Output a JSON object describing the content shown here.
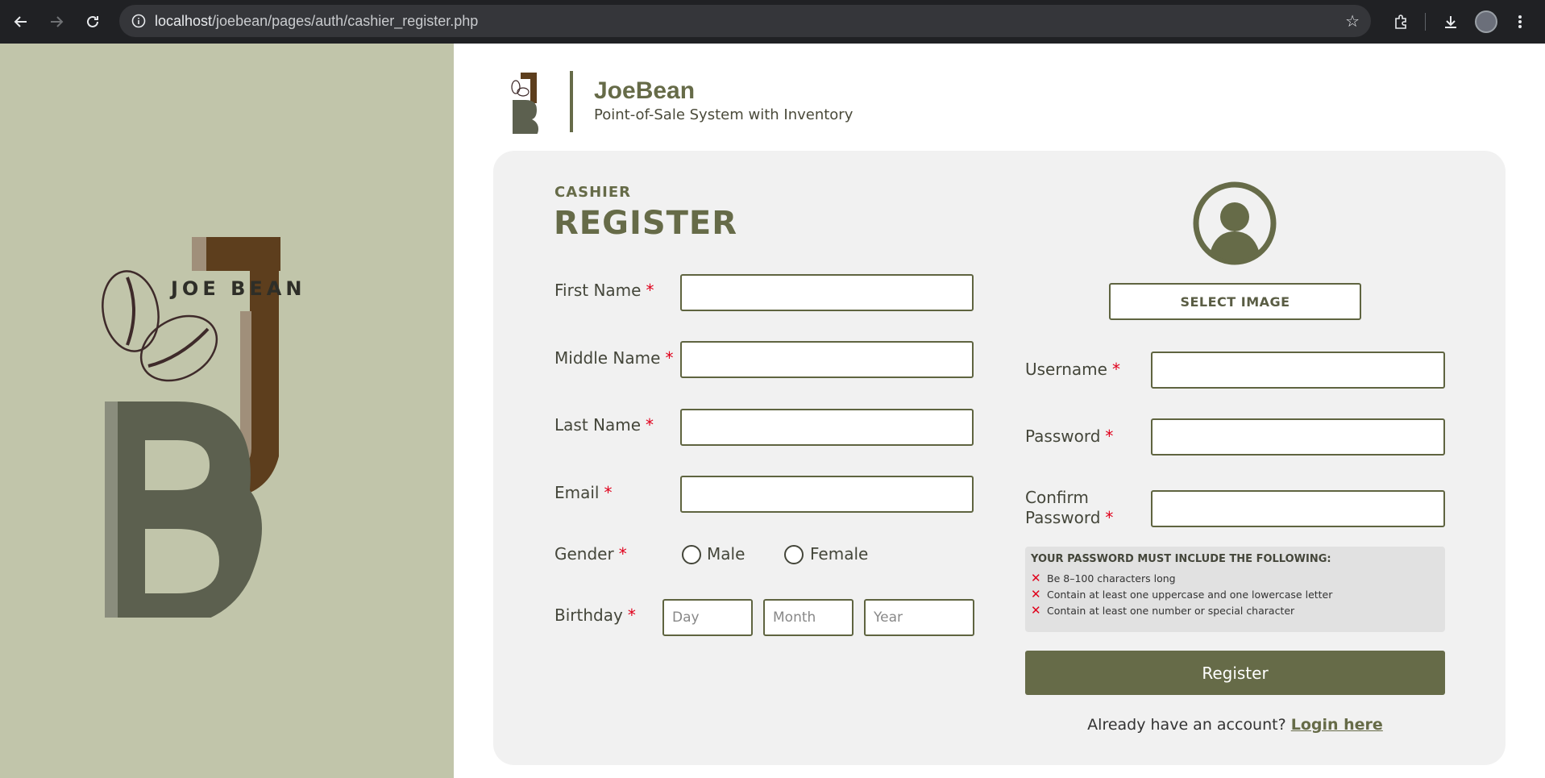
{
  "browser": {
    "url_host": "localhost",
    "url_path": "/joebean/pages/auth/cashier_register.php",
    "icons": [
      "back-icon",
      "forward-icon",
      "reload-icon",
      "info-icon",
      "star-icon",
      "extensions-icon",
      "download-icon",
      "profile-avatar"
    ]
  },
  "brand": {
    "logo_text": "JOE BEAN",
    "title": "JoeBean",
    "subtitle": "Point-of-Sale System with Inventory"
  },
  "form": {
    "eyebrow": "CASHIER",
    "heading": "REGISTER",
    "required_mark": "*",
    "first_name_label": "First Name",
    "middle_name_label": "Middle Name",
    "last_name_label": "Last Name",
    "email_label": "Email",
    "gender_label": "Gender",
    "gender_male": "Male",
    "gender_female": "Female",
    "birthday_label": "Birthday",
    "day_placeholder": "Day",
    "month_placeholder": "Month",
    "year_placeholder": "Year",
    "select_image": "SELECT IMAGE",
    "username_label": "Username",
    "password_label": "Password",
    "confirm_label_1": "Confirm",
    "confirm_label_2": "Password",
    "rules_title": "YOUR PASSWORD MUST INCLUDE THE FOLLOWING:",
    "rules": [
      "Be 8–100 characters long",
      "Contain at least one uppercase and one lowercase letter",
      "Contain at least one number or special character"
    ],
    "register_button": "Register",
    "login_prompt": "Already have an account?",
    "login_link": "Login here"
  },
  "colors": {
    "accent": "#666b48",
    "left_panel": "#c1c5aa",
    "card": "#f1f1f1",
    "required": "#e0001b"
  }
}
